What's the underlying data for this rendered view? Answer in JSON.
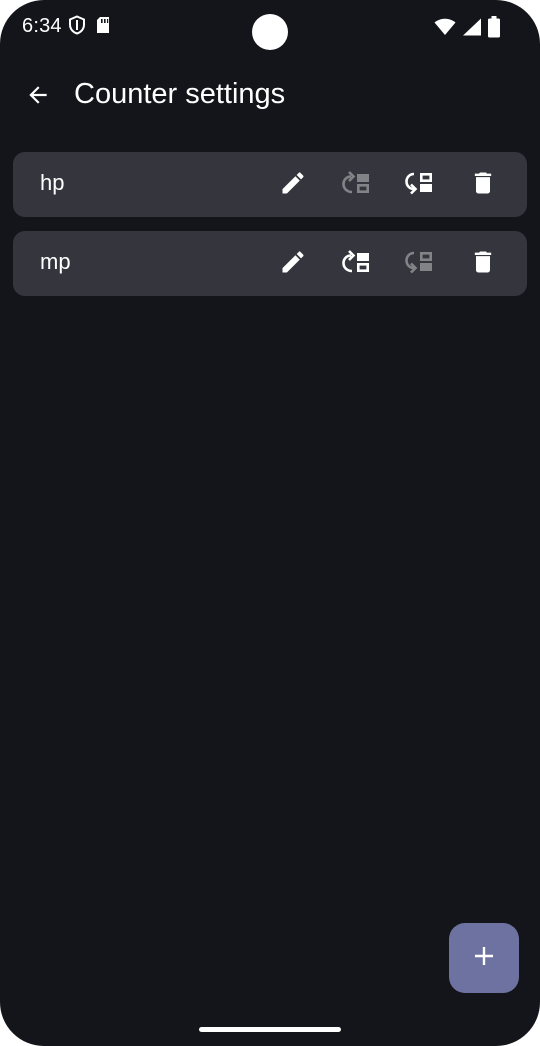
{
  "status_bar": {
    "time": "6:34",
    "left_icons": [
      "shield-icon",
      "sd-card-icon"
    ],
    "right_icons": [
      "wifi-icon",
      "cell-signal-icon",
      "battery-icon"
    ]
  },
  "app_bar": {
    "back_icon": "arrow-back-icon",
    "title": "Counter settings"
  },
  "counters": [
    {
      "name": "hp",
      "actions": {
        "edit": "edit-icon",
        "move_up": {
          "icon": "move-up-icon",
          "enabled": false
        },
        "move_down": {
          "icon": "move-down-icon",
          "enabled": true
        },
        "delete": "delete-icon"
      }
    },
    {
      "name": "mp",
      "actions": {
        "edit": "edit-icon",
        "move_up": {
          "icon": "move-up-icon",
          "enabled": true
        },
        "move_down": {
          "icon": "move-down-icon",
          "enabled": false
        },
        "delete": "delete-icon"
      }
    }
  ],
  "fab": {
    "icon": "add-icon"
  },
  "colors": {
    "background": "#14151a",
    "row": "#35363d",
    "fab": "#6e72a0",
    "text": "#ffffff"
  }
}
